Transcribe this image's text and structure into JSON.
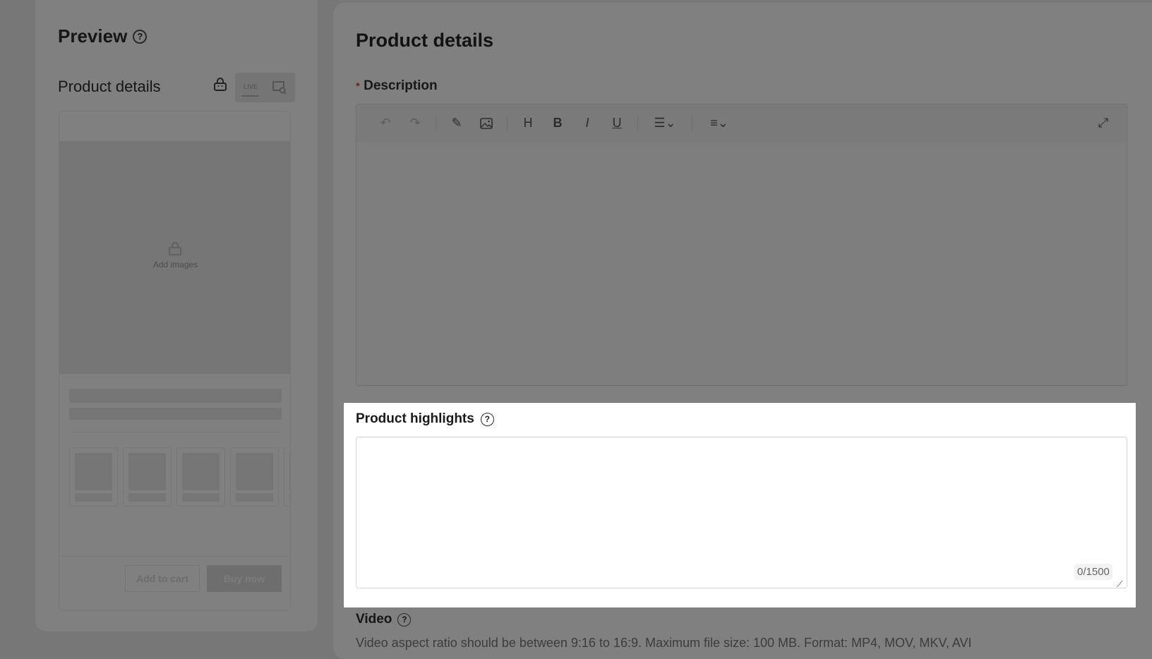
{
  "preview": {
    "title": "Preview",
    "section_title": "Product details",
    "add_images": "Add images",
    "add_to_cart": "Add to cart",
    "buy_now": "Buy now",
    "live_icon_text": "LIVE"
  },
  "main": {
    "title": "Product details",
    "description_label": "Description",
    "required_mark": "*",
    "toolbar": {
      "heading": "H",
      "bold": "B",
      "italic": "I",
      "underline": "U"
    },
    "highlights_label": "Product highlights",
    "highlights_value": "",
    "highlights_counter": "0/1500",
    "video_label": "Video",
    "video_hint": "Video aspect ratio should be between 9:16 to 16:9. Maximum file size: 100 MB. Format: MP4, MOV, MKV, AVI"
  }
}
